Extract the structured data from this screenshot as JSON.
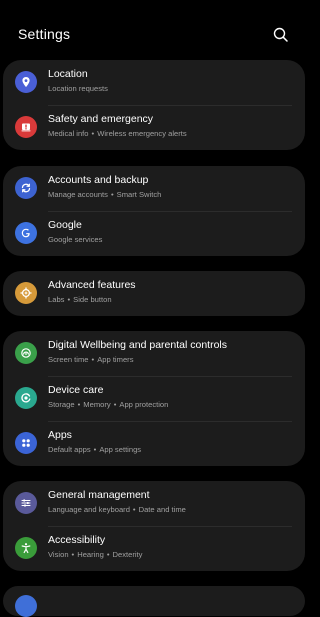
{
  "header": {
    "title": "Settings",
    "search_icon": "search-icon"
  },
  "groups": [
    {
      "items": [
        {
          "id": "location",
          "label": "Location",
          "sub": [
            "Location requests"
          ],
          "icon": "location-pin-icon",
          "color": "#4a5fd6"
        },
        {
          "id": "safety",
          "label": "Safety and emergency",
          "sub": [
            "Medical info",
            "Wireless emergency alerts"
          ],
          "icon": "emergency-icon",
          "color": "#d93a3a"
        }
      ]
    },
    {
      "items": [
        {
          "id": "accounts",
          "label": "Accounts and backup",
          "sub": [
            "Manage accounts",
            "Smart Switch"
          ],
          "icon": "sync-icon",
          "color": "#3d63d1"
        },
        {
          "id": "google",
          "label": "Google",
          "sub": [
            "Google services"
          ],
          "icon": "google-icon",
          "color": "#3d72e0"
        }
      ]
    },
    {
      "items": [
        {
          "id": "advanced",
          "label": "Advanced features",
          "sub": [
            "Labs",
            "Side button"
          ],
          "icon": "gear-plus-icon",
          "color": "#d69a3a"
        }
      ]
    },
    {
      "items": [
        {
          "id": "wellbeing",
          "label": "Digital Wellbeing and parental controls",
          "sub": [
            "Screen time",
            "App timers"
          ],
          "icon": "wellbeing-icon",
          "color": "#3aa04a"
        },
        {
          "id": "devicecare",
          "label": "Device care",
          "sub": [
            "Storage",
            "Memory",
            "App protection"
          ],
          "icon": "device-care-icon",
          "color": "#2aa88f"
        },
        {
          "id": "apps",
          "label": "Apps",
          "sub": [
            "Default apps",
            "App settings"
          ],
          "icon": "apps-grid-icon",
          "color": "#3b64d6"
        }
      ]
    },
    {
      "items": [
        {
          "id": "general",
          "label": "General management",
          "sub": [
            "Language and keyboard",
            "Date and time"
          ],
          "icon": "sliders-icon",
          "color": "#5a5a9a"
        },
        {
          "id": "accessibility",
          "label": "Accessibility",
          "sub": [
            "Vision",
            "Hearing",
            "Dexterity"
          ],
          "icon": "accessibility-icon",
          "color": "#3a9c3a"
        }
      ]
    }
  ]
}
